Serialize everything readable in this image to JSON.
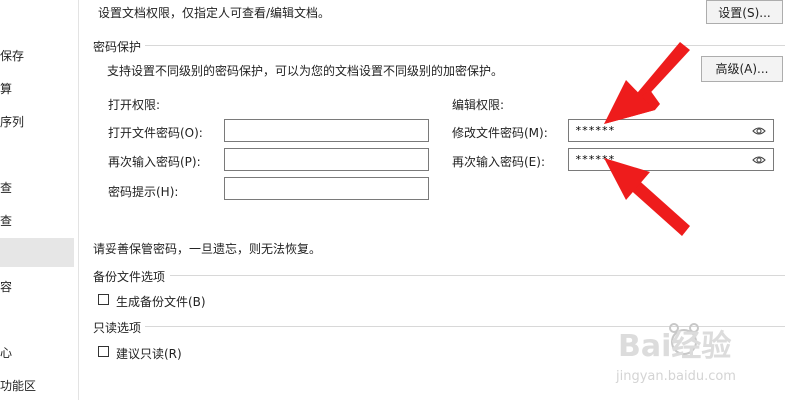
{
  "sidebar": {
    "items": [
      "保存",
      "算",
      "序列",
      "查",
      "查",
      "容",
      "心",
      "功能区"
    ]
  },
  "permissions": {
    "description": "设置文档权限，仅指定人可查看/编辑文档。",
    "button": "设置(S)..."
  },
  "password_protection": {
    "section_title": "密码保护",
    "description": "支持设置不同级别的密码保护，可以为您的文档设置不同级别的加密保护。",
    "advanced_button": "高级(A)...",
    "open_group": {
      "title": "打开权限:",
      "open_password_label": "打开文件密码(O):",
      "reenter_label": "再次输入密码(P):",
      "hint_label": "密码提示(H):"
    },
    "edit_group": {
      "title": "编辑权限:",
      "modify_password_label": "修改文件密码(M):",
      "modify_password_value": "******",
      "reenter_label": "再次输入密码(E):",
      "reenter_value": "******"
    },
    "warning": "请妥善保管密码，一旦遗忘，则无法恢复。"
  },
  "backup": {
    "section_title": "备份文件选项",
    "checkbox_label": "生成备份文件(B)",
    "checked": false
  },
  "readonly": {
    "section_title": "只读选项",
    "checkbox_label": "建议只读(R)",
    "checked": false
  },
  "watermark": {
    "brand": "Bai经验",
    "url": "jingyan.baidu.com"
  },
  "colors": {
    "arrow": "#ee1c1c",
    "sidebar_selected": "#e6e6e6",
    "button_bg": "#f3f3f3"
  }
}
